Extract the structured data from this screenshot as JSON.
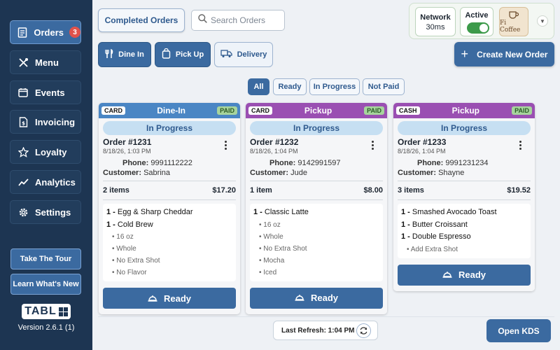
{
  "sidebar": {
    "items": [
      {
        "label": "Orders",
        "icon": "receipt-icon",
        "badge": "3",
        "active": true
      },
      {
        "label": "Menu",
        "icon": "utensils-icon"
      },
      {
        "label": "Events",
        "icon": "calendar-icon"
      },
      {
        "label": "Invoicing",
        "icon": "invoice-icon"
      },
      {
        "label": "Loyalty",
        "icon": "star-icon"
      },
      {
        "label": "Analytics",
        "icon": "chart-line-icon"
      },
      {
        "label": "Settings",
        "icon": "gear-icon"
      }
    ],
    "tour_label": "Take The Tour",
    "whats_new_label": "Learn What's New",
    "logo_text": "TABL",
    "version": "Version 2.6.1 (1)"
  },
  "header": {
    "completed_orders_label": "Completed Orders",
    "search_placeholder": "Search Orders",
    "network_label": "Network",
    "network_value": "30ms",
    "active_label": "Active",
    "active_on": true,
    "avatar_text": "Fi Coffee",
    "create_order_label": "Create New Order",
    "order_types": [
      {
        "label": "Dine In",
        "icon": "utensils-icon",
        "style": "solid"
      },
      {
        "label": "Pick Up",
        "icon": "bag-icon",
        "style": "solid"
      },
      {
        "label": "Delivery",
        "icon": "truck-icon",
        "style": "light"
      }
    ]
  },
  "filters": [
    {
      "label": "All",
      "selected": true
    },
    {
      "label": "Ready",
      "selected": false
    },
    {
      "label": "In Progress",
      "selected": false
    },
    {
      "label": "Not Paid",
      "selected": false
    }
  ],
  "colors": {
    "dine_in": "#4a86c4",
    "pickup": "#9a4fb2",
    "primary": "#3b6aa0",
    "sidebar": "#1d3552"
  },
  "orders": [
    {
      "payment": "CARD",
      "type": "Dine-In",
      "paid": "PAID",
      "status": "In Progress",
      "order_number": "Order #1231",
      "date": "8/18/26, 1:03 PM",
      "phone_label": "Phone:",
      "phone": "9991112222",
      "customer_label": "Customer:",
      "customer": "Sabrina",
      "item_count": "2 items",
      "total": "$17.20",
      "lines": [
        {
          "kind": "item",
          "qty": "1 -",
          "name": "Egg & Sharp Cheddar"
        },
        {
          "kind": "item",
          "qty": "1 -",
          "name": "Cold Brew"
        },
        {
          "kind": "mod",
          "text": "16 oz"
        },
        {
          "kind": "mod",
          "text": "Whole"
        },
        {
          "kind": "mod",
          "text": "No Extra Shot"
        },
        {
          "kind": "mod",
          "text": "No Flavor"
        }
      ],
      "ready_label": "Ready"
    },
    {
      "payment": "CARD",
      "type": "Pickup",
      "paid": "PAID",
      "status": "In Progress",
      "order_number": "Order #1232",
      "date": "8/18/26, 1:04 PM",
      "phone_label": "Phone:",
      "phone": "9142991597",
      "customer_label": "Customer:",
      "customer": "Jude",
      "item_count": "1 item",
      "total": "$8.00",
      "lines": [
        {
          "kind": "item",
          "qty": "1 -",
          "name": "Classic Latte"
        },
        {
          "kind": "mod",
          "text": "16 oz"
        },
        {
          "kind": "mod",
          "text": "Whole"
        },
        {
          "kind": "mod",
          "text": "No Extra Shot"
        },
        {
          "kind": "mod",
          "text": "Mocha"
        },
        {
          "kind": "mod",
          "text": "Iced"
        }
      ],
      "ready_label": "Ready"
    },
    {
      "payment": "CASH",
      "type": "Pickup",
      "paid": "PAID",
      "status": "In Progress",
      "order_number": "Order #1233",
      "date": "8/18/26, 1:04 PM",
      "phone_label": "Phone:",
      "phone": "9991231234",
      "customer_label": "Customer:",
      "customer": "Shayne",
      "item_count": "3 items",
      "total": "$19.52",
      "lines": [
        {
          "kind": "item",
          "qty": "1 -",
          "name": "Smashed Avocado Toast"
        },
        {
          "kind": "item",
          "qty": "1 -",
          "name": "Butter Croissant"
        },
        {
          "kind": "item",
          "qty": "1 -",
          "name": "Double Espresso"
        },
        {
          "kind": "mod",
          "text": "Add Extra Shot"
        }
      ],
      "ready_label": "Ready"
    }
  ],
  "footer": {
    "last_refresh": "Last Refresh: 1:04 PM",
    "open_kds_label": "Open KDS"
  }
}
